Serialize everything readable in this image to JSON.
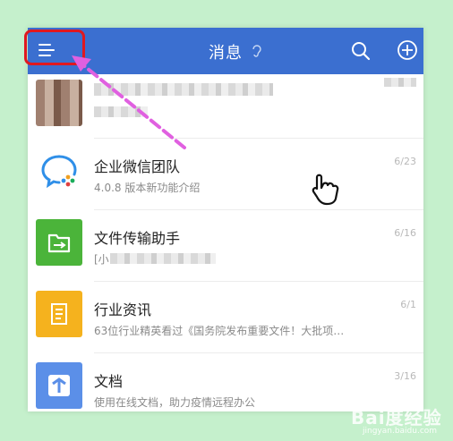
{
  "header": {
    "title": "消息",
    "icons": [
      "menu-icon",
      "ear-icon",
      "search-icon",
      "add-icon"
    ]
  },
  "conversations": [
    {
      "name": "企业微信团队",
      "preview": "4.0.8 版本新功能介绍",
      "date": "6/23",
      "icon": "wecom-logo-icon"
    },
    {
      "name": "文件传输助手",
      "preview": "[小",
      "date": "6/16",
      "icon": "folder-transfer-icon"
    },
    {
      "name": "行业资讯",
      "preview": "63位行业精英看过《国务院发布重要文件！大批项…",
      "date": "6/1",
      "icon": "news-document-icon"
    },
    {
      "name": "文档",
      "preview": "使用在线文档，助力疫情远程办公",
      "date": "3/16",
      "icon": "doc-icon"
    }
  ],
  "colors": {
    "header": "#3b6fd0",
    "background": "#c5f0cc",
    "annotation_red": "#e01820",
    "annotation_arrow": "#e060e0",
    "folder_green": "#4bb43a",
    "news_yellow": "#f5b21e",
    "doc_blue": "#5b8fe8"
  },
  "watermark": {
    "text": "Bai度经验",
    "sub": "jingyan.baidu.com"
  }
}
